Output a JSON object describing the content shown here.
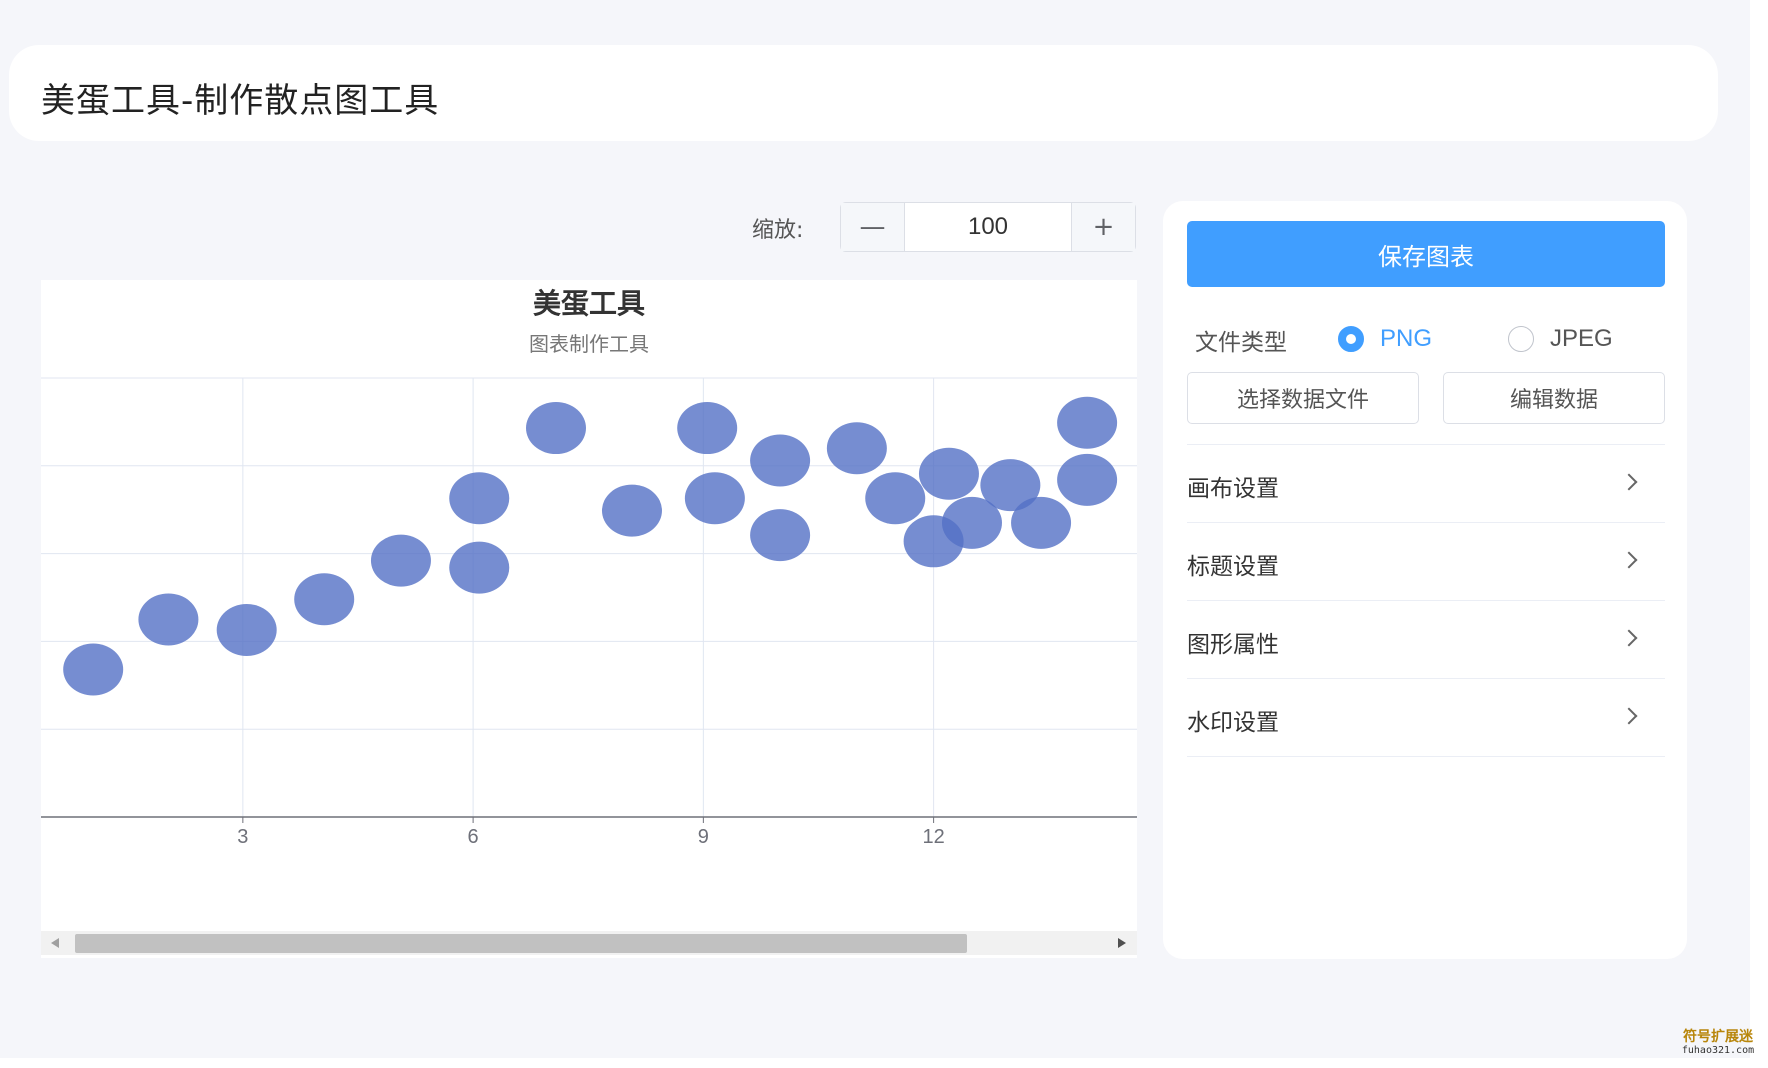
{
  "header": {
    "title": "美蛋工具-制作散点图工具"
  },
  "zoom": {
    "label": "缩放:",
    "minus_label": "—",
    "plus_label": "+",
    "value": "100"
  },
  "actions": {
    "save_label": "保存图表",
    "file_type_label": "文件类型",
    "file_types": [
      {
        "label": "PNG",
        "checked": true
      },
      {
        "label": "JPEG",
        "checked": false
      }
    ],
    "select_file_label": "选择数据文件",
    "edit_data_label": "编辑数据"
  },
  "sections": [
    {
      "label": "画布设置"
    },
    {
      "label": "标题设置"
    },
    {
      "label": "图形属性"
    },
    {
      "label": "水印设置"
    }
  ],
  "colors": {
    "accent": "#409eff",
    "marker": "#5470c6"
  },
  "watermark": {
    "line1": "符号扩展迷",
    "line2": "fuhao321.com"
  },
  "chart_data": {
    "type": "scatter",
    "title": "美蛋工具",
    "subtitle": "图表制作工具",
    "xlabel": "",
    "ylabel": "",
    "x_ticks": [
      3,
      6,
      9,
      12
    ],
    "xlim": [
      0.37,
      14.65
    ],
    "ylim": [
      0,
      5
    ],
    "grid": true,
    "points": [
      {
        "x": 1.05,
        "y": 1.68
      },
      {
        "x": 2.03,
        "y": 2.25
      },
      {
        "x": 3.05,
        "y": 2.13
      },
      {
        "x": 4.06,
        "y": 2.48
      },
      {
        "x": 5.06,
        "y": 2.92
      },
      {
        "x": 6.08,
        "y": 2.84
      },
      {
        "x": 6.08,
        "y": 3.63
      },
      {
        "x": 7.08,
        "y": 4.43
      },
      {
        "x": 8.07,
        "y": 3.49
      },
      {
        "x": 9.05,
        "y": 4.43
      },
      {
        "x": 9.15,
        "y": 3.63
      },
      {
        "x": 10.0,
        "y": 4.06
      },
      {
        "x": 10.0,
        "y": 3.21
      },
      {
        "x": 11.0,
        "y": 4.2
      },
      {
        "x": 11.5,
        "y": 3.63
      },
      {
        "x": 12.0,
        "y": 3.14
      },
      {
        "x": 12.2,
        "y": 3.91
      },
      {
        "x": 12.5,
        "y": 3.35
      },
      {
        "x": 13.0,
        "y": 3.78
      },
      {
        "x": 13.4,
        "y": 3.35
      },
      {
        "x": 14.0,
        "y": 4.49
      },
      {
        "x": 14.0,
        "y": 3.84
      }
    ]
  }
}
